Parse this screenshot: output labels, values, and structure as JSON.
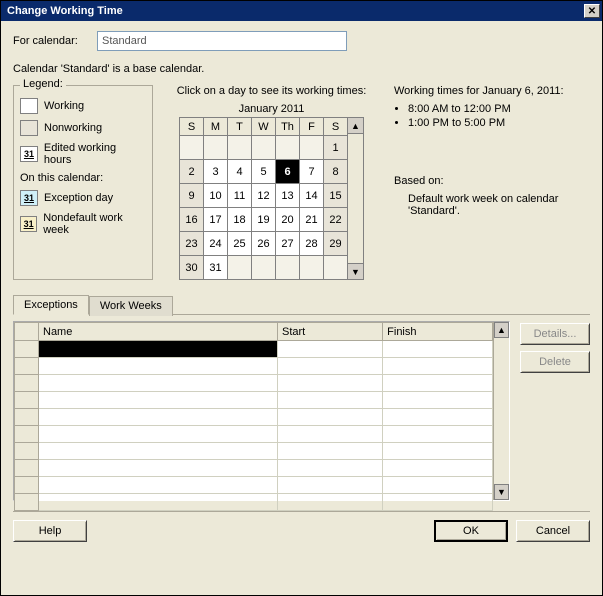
{
  "window": {
    "title": "Change Working Time",
    "close_glyph": "✕"
  },
  "for_calendar": {
    "label": "For calendar:",
    "value": "Standard"
  },
  "baseline": "Calendar 'Standard' is a base calendar.",
  "legend": {
    "title": "Legend:",
    "working": "Working",
    "nonworking": "Nonworking",
    "edited": "Edited working hours",
    "edited_num": "31",
    "subhead": "On this calendar:",
    "exception": "Exception day",
    "exception_num": "31",
    "nondefault": "Nondefault work week",
    "nondefault_num": "31"
  },
  "calendar": {
    "hint": "Click on a day to see its working times:",
    "prev": "◄",
    "next": "►",
    "month": "January 2011",
    "dow": [
      "S",
      "M",
      "T",
      "W",
      "Th",
      "F",
      "S"
    ],
    "weeks": [
      [
        {
          "d": "",
          "t": "empty"
        },
        {
          "d": "",
          "t": "empty"
        },
        {
          "d": "",
          "t": "empty"
        },
        {
          "d": "",
          "t": "empty"
        },
        {
          "d": "",
          "t": "empty"
        },
        {
          "d": "",
          "t": "empty"
        },
        {
          "d": "1",
          "t": "weekend"
        }
      ],
      [
        {
          "d": "2",
          "t": "weekend"
        },
        {
          "d": "3",
          "t": "work"
        },
        {
          "d": "4",
          "t": "work"
        },
        {
          "d": "5",
          "t": "work"
        },
        {
          "d": "6",
          "t": "selected"
        },
        {
          "d": "7",
          "t": "work"
        },
        {
          "d": "8",
          "t": "weekend"
        }
      ],
      [
        {
          "d": "9",
          "t": "weekend"
        },
        {
          "d": "10",
          "t": "work"
        },
        {
          "d": "11",
          "t": "work"
        },
        {
          "d": "12",
          "t": "work"
        },
        {
          "d": "13",
          "t": "work"
        },
        {
          "d": "14",
          "t": "work"
        },
        {
          "d": "15",
          "t": "weekend"
        }
      ],
      [
        {
          "d": "16",
          "t": "weekend"
        },
        {
          "d": "17",
          "t": "work"
        },
        {
          "d": "18",
          "t": "work"
        },
        {
          "d": "19",
          "t": "work"
        },
        {
          "d": "20",
          "t": "work"
        },
        {
          "d": "21",
          "t": "work"
        },
        {
          "d": "22",
          "t": "weekend"
        }
      ],
      [
        {
          "d": "23",
          "t": "weekend"
        },
        {
          "d": "24",
          "t": "work"
        },
        {
          "d": "25",
          "t": "work"
        },
        {
          "d": "26",
          "t": "work"
        },
        {
          "d": "27",
          "t": "work"
        },
        {
          "d": "28",
          "t": "work"
        },
        {
          "d": "29",
          "t": "weekend"
        }
      ],
      [
        {
          "d": "30",
          "t": "weekend"
        },
        {
          "d": "31",
          "t": "work"
        },
        {
          "d": "",
          "t": "empty"
        },
        {
          "d": "",
          "t": "empty"
        },
        {
          "d": "",
          "t": "empty"
        },
        {
          "d": "",
          "t": "empty"
        },
        {
          "d": "",
          "t": "empty"
        }
      ]
    ],
    "scroll_up": "▲",
    "scroll_down": "▼"
  },
  "details": {
    "header": "Working times for January 6, 2011:",
    "times": [
      "8:00 AM to 12:00 PM",
      "1:00 PM to 5:00 PM"
    ],
    "based_on_label": "Based on:",
    "based_on_text": "Default work week on calendar 'Standard'."
  },
  "tabs": {
    "exceptions": "Exceptions",
    "workweeks": "Work Weeks"
  },
  "table": {
    "cols": {
      "name": "Name",
      "start": "Start",
      "finish": "Finish"
    },
    "rows": 10
  },
  "buttons": {
    "details": "Details...",
    "delete": "Delete",
    "help": "Help",
    "ok": "OK",
    "cancel": "Cancel"
  }
}
